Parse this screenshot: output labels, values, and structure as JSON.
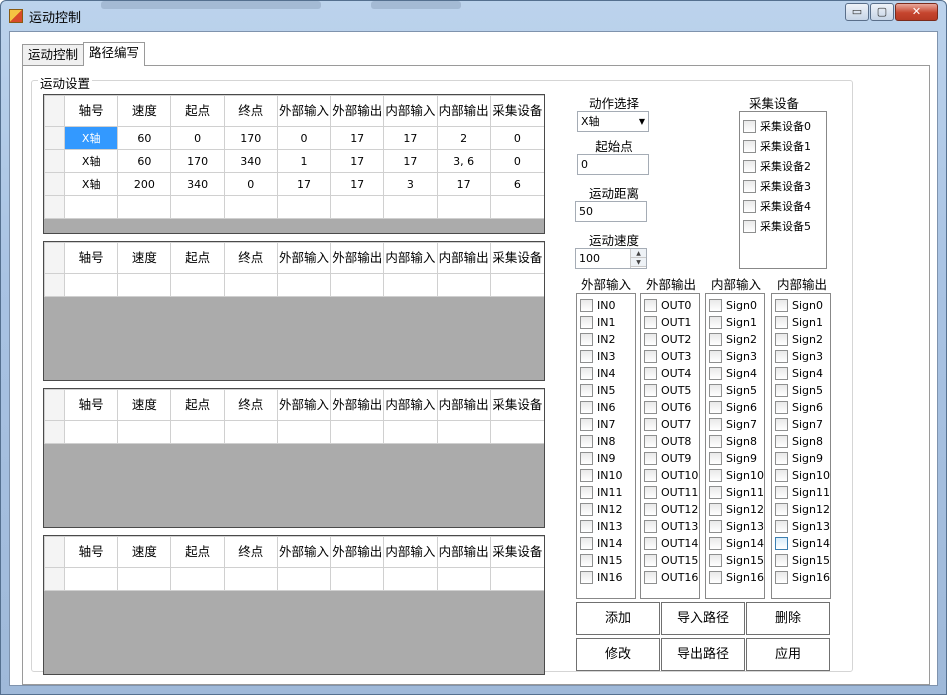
{
  "window": {
    "title": "运动控制",
    "min_glyph": "▭",
    "max_glyph": "▢",
    "close_glyph": "✕"
  },
  "tabs": [
    {
      "label": "运动控制"
    },
    {
      "label": "路径编写"
    }
  ],
  "group_title": "运动设置",
  "columns": [
    "轴号",
    "速度",
    "起点",
    "终点",
    "外部输入",
    "外部输出",
    "内部输入",
    "内部输出",
    "采集设备"
  ],
  "grid1_rows": [
    [
      "X轴",
      "60",
      "0",
      "170",
      "0",
      "17",
      "17",
      "2",
      "0"
    ],
    [
      "X轴",
      "60",
      "170",
      "340",
      "1",
      "17",
      "17",
      "3, 6",
      "0"
    ],
    [
      "X轴",
      "200",
      "340",
      "0",
      "17",
      "17",
      "3",
      "17",
      "6"
    ],
    [
      "",
      "",
      "",
      "",
      "",
      "",
      "",
      "",
      ""
    ]
  ],
  "controls": {
    "action_label": "动作选择",
    "action_value": "X轴",
    "start_label": "起始点",
    "start_value": "0",
    "distance_label": "运动距离",
    "distance_value": "50",
    "speed_label": "运动速度",
    "speed_value": "100"
  },
  "collect": {
    "title": "采集设备",
    "items": [
      "采集设备0",
      "采集设备1",
      "采集设备2",
      "采集设备3",
      "采集设备4",
      "采集设备5"
    ]
  },
  "io": {
    "ext_in": {
      "title": "外部输入",
      "items": [
        "IN0",
        "IN1",
        "IN2",
        "IN3",
        "IN4",
        "IN5",
        "IN6",
        "IN7",
        "IN8",
        "IN9",
        "IN10",
        "IN11",
        "IN12",
        "IN13",
        "IN14",
        "IN15",
        "IN16"
      ]
    },
    "ext_out": {
      "title": "外部输出",
      "items": [
        "OUT0",
        "OUT1",
        "OUT2",
        "OUT3",
        "OUT4",
        "OUT5",
        "OUT6",
        "OUT7",
        "OUT8",
        "OUT9",
        "OUT10",
        "OUT11",
        "OUT12",
        "OUT13",
        "OUT14",
        "OUT15",
        "OUT16"
      ]
    },
    "int_in": {
      "title": "内部输入",
      "items": [
        "Sign0",
        "Sign1",
        "Sign2",
        "Sign3",
        "Sign4",
        "Sign5",
        "Sign6",
        "Sign7",
        "Sign8",
        "Sign9",
        "Sign10",
        "Sign11",
        "Sign12",
        "Sign13",
        "Sign14",
        "Sign15",
        "Sign16"
      ]
    },
    "int_out": {
      "title": "内部输出",
      "items": [
        "Sign0",
        "Sign1",
        "Sign2",
        "Sign3",
        "Sign4",
        "Sign5",
        "Sign6",
        "Sign7",
        "Sign8",
        "Sign9",
        "Sign10",
        "Sign11",
        "Sign12",
        "Sign13",
        "Sign14",
        "Sign15",
        "Sign16"
      ]
    }
  },
  "buttons": {
    "add": "添加",
    "import": "导入路径",
    "delete": "删除",
    "modify": "修改",
    "export": "导出路径",
    "apply": "应用"
  }
}
